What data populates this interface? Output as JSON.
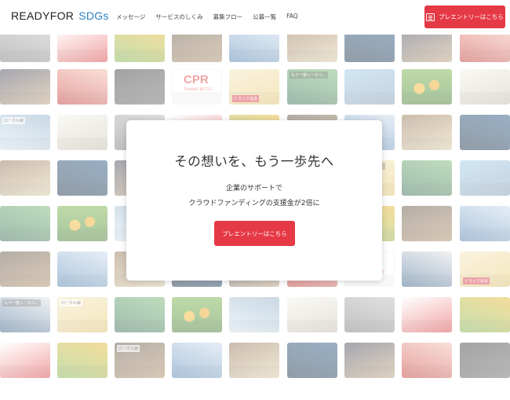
{
  "header": {
    "logo_main": "READYFOR",
    "logo_sub": "SDGs",
    "nav": [
      "メッセージ",
      "サービスのしくみ",
      "募集フロー",
      "公募一覧",
      "FAQ"
    ],
    "cta_label": "プレエントリーはこちら"
  },
  "hero": {
    "title": "その想いを、もう一歩先へ",
    "line1": "企業のサポートで",
    "line2": "クラウドファンディングの支援金が2倍に",
    "button_label": "プレエントリーはこちら"
  },
  "tiles": {
    "cpr_big": "CPR",
    "cpr_sub": "TRAINING BOTTLE",
    "track_label": "トラック協会",
    "rail_label": "もう一度レースへ。",
    "yuzu_label": "柚、日本一の里",
    "dontoko_label": "どんとこい",
    "station_label": "ローカル線",
    "mountain_label": "山の駅"
  },
  "colors": {
    "accent": "#e63946",
    "sdgs_blue": "#2c7fc1"
  }
}
